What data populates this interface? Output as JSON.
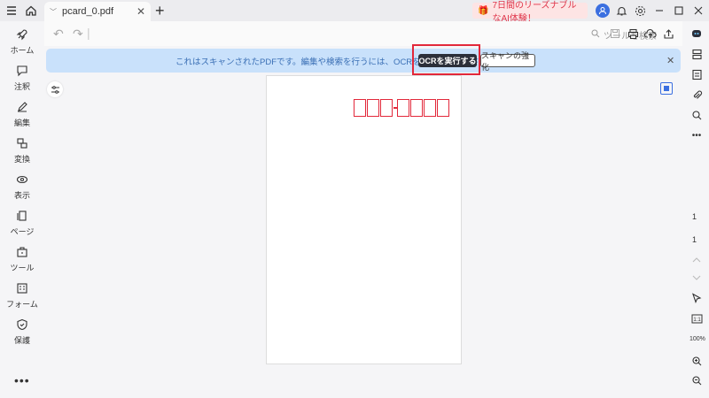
{
  "titlebar": {
    "tab_title": "pcard_0.pdf",
    "promo_text": "7日間のリーズナブルなAI体験！"
  },
  "sidebar": {
    "items": [
      {
        "label": "ホーム",
        "icon": "rocket-icon"
      },
      {
        "label": "注釈",
        "icon": "comment-icon"
      },
      {
        "label": "編集",
        "icon": "edit-icon"
      },
      {
        "label": "変換",
        "icon": "convert-icon"
      },
      {
        "label": "表示",
        "icon": "eye-icon"
      },
      {
        "label": "ページ",
        "icon": "page-icon"
      },
      {
        "label": "ツール",
        "icon": "toolbox-icon"
      },
      {
        "label": "フォーム",
        "icon": "form-icon"
      },
      {
        "label": "保護",
        "icon": "shield-icon"
      }
    ],
    "more": "•••"
  },
  "toolbar": {
    "search_placeholder": "ツールを検索"
  },
  "banner": {
    "message": "これはスキャンされたPDFです。編集や検索を行うには、OCRを実行してください。",
    "ocr_button": "OCRを実行する",
    "enhance_button": "スキャンの強化",
    "accent": "#e2283a"
  },
  "viewer": {
    "page_current": "1",
    "page_total": "1",
    "zoom": "100%"
  }
}
